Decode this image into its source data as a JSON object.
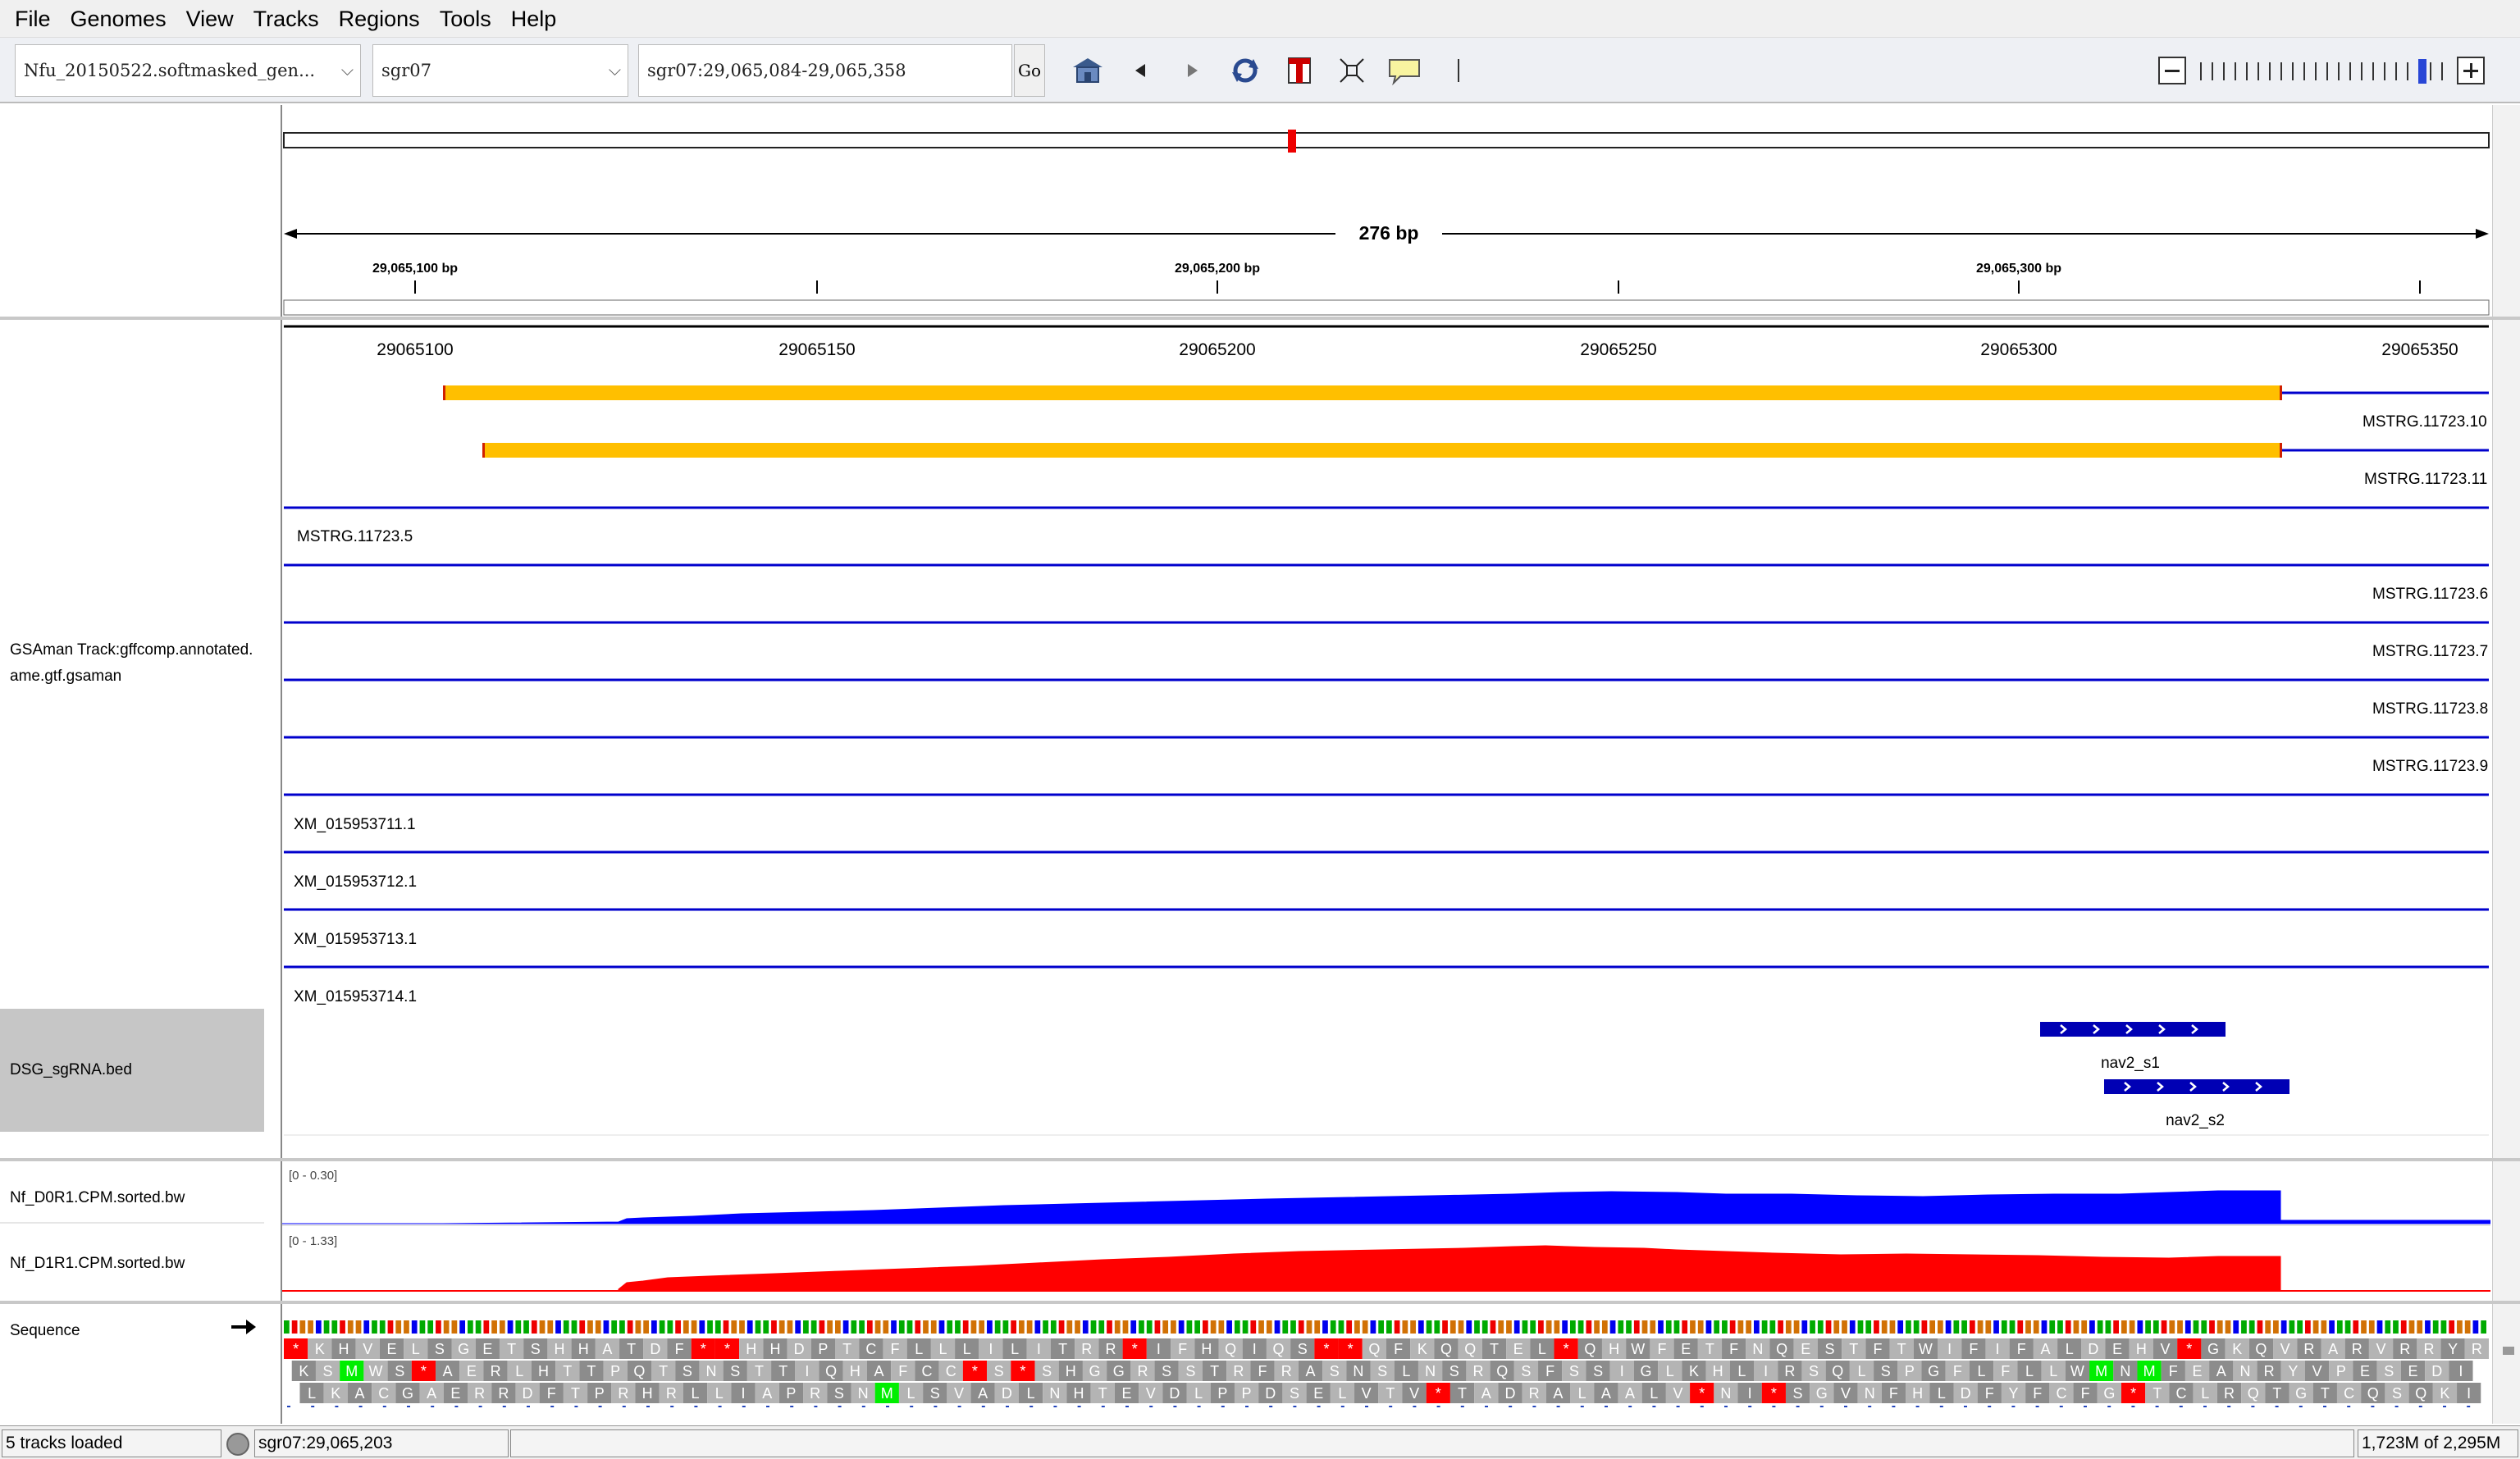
{
  "menu": [
    "File",
    "Genomes",
    "View",
    "Tracks",
    "Regions",
    "Tools",
    "Help"
  ],
  "toolbar": {
    "genome": "Nfu_20150522.softmasked_gen...",
    "chromosome": "sgr07",
    "locus": "sgr07:29,065,084-29,065,358",
    "go_label": "Go"
  },
  "ruler": {
    "width_label": "276 bp",
    "major_ticks": [
      "29,065,100 bp",
      "29,065,200 bp",
      "29,065,300 bp"
    ],
    "coord_ticks": [
      "29065100",
      "29065150",
      "29065200",
      "29065250",
      "29065300",
      "29065350"
    ]
  },
  "features": {
    "track_name": "GSAman Track:gffcomp.annotated.ame.gtf.gsaman",
    "track_name_line1": "GSAman Track:gffcomp.annotated.",
    "track_name_line2": "ame.gtf.gsaman",
    "transcripts": [
      "MSTRG.11723.10",
      "MSTRG.11723.11",
      "MSTRG.11723.5",
      "MSTRG.11723.6",
      "MSTRG.11723.7",
      "MSTRG.11723.8",
      "MSTRG.11723.9",
      "XM_015953711.1",
      "XM_015953712.1",
      "XM_015953713.1",
      "XM_015953714.1"
    ]
  },
  "bed": {
    "track_name": "DSG_sgRNA.bed",
    "items": [
      "nav2_s1",
      "nav2_s2"
    ]
  },
  "coverage": [
    {
      "name": "Nf_D0R1.CPM.sorted.bw",
      "range": "[0 - 0.30]",
      "color": "#0000ff"
    },
    {
      "name": "Nf_D1R1.CPM.sorted.bw",
      "range": "[0 - 1.33]",
      "color": "#ff0000"
    }
  ],
  "sequence": {
    "label": "Sequence",
    "frame1": "*KHVELSGETSHHATDF**HHDPTCFLLLILITRR*IFHQIQS**QFKQQTEL*QHWFETFNQESTFTWIFIFALDEHV*GKQVRARVRRYR",
    "frame2": "KSMWS*AERLHTTPQTSNSTTIQHAFCC*S*SHGGRSSTRFRASNSLNSRQSFSSIGLKHLIRSQLSPGFLFLLWMNMFEANRYVPESEDI",
    "frame3": "LKACGAERRDFTPRHRLLIAPRSNMLSVADLNHTEVDLPPDSELVTV*TADRALAALV*NI*SGVNFHLDFYFCFG*TCLRQTGTCQSQKI*"
  },
  "status": {
    "tracks_loaded": "5 tracks loaded",
    "position": "sgr07:29,065,203",
    "memory": "1,723M of 2,295M"
  },
  "colors": {
    "exon": "#ffbf00",
    "intron": "#0000cc",
    "bed": "#0000b4",
    "stop": "#ff0000",
    "start": "#00ee00"
  }
}
